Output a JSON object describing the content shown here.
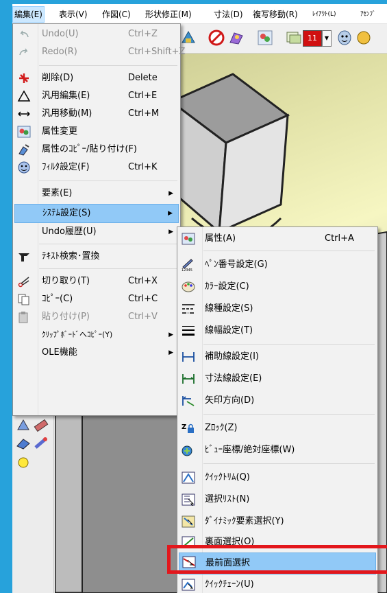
{
  "menubar": {
    "items": [
      {
        "label": "編集(E)"
      },
      {
        "label": "表示(V)"
      },
      {
        "label": "作図(C)"
      },
      {
        "label": "形状修正(M)"
      },
      {
        "label": "寸法(D)"
      },
      {
        "label": "複写移動(R)"
      },
      {
        "label": "ﾚｲｱｳﾄ(L)"
      },
      {
        "label": "ｱｾﾝﾌﾞ"
      }
    ]
  },
  "toolbar": {
    "color_value": "11",
    "colors": {
      "accent": "#e3171c",
      "selection": "#91c9f7",
      "background": "#27a2db"
    }
  },
  "edit_menu": {
    "items": [
      {
        "label": "Undo(U)",
        "shortcut": "Ctrl+Z",
        "icon": "undo-icon",
        "disabled": true
      },
      {
        "label": "Redo(R)",
        "shortcut": "Ctrl+Shift+Z",
        "icon": "redo-icon",
        "disabled": true
      },
      {
        "label": "削除(D)",
        "shortcut": "Delete",
        "icon": "delete-icon"
      },
      {
        "label": "汎用編集(E)",
        "shortcut": "Ctrl+E",
        "icon": "triangle-icon"
      },
      {
        "label": "汎用移動(M)",
        "shortcut": "Ctrl+M",
        "icon": "move-arrows-icon"
      },
      {
        "label": "属性変更",
        "shortcut": "",
        "icon": "attribute-change-icon"
      },
      {
        "label": "属性のｺﾋﾟｰ/貼り付け(F)",
        "shortcut": "",
        "icon": "attribute-copy-icon"
      },
      {
        "label": "ﾌｨﾙﾀ設定(F)",
        "shortcut": "Ctrl+K",
        "icon": "filter-icon"
      },
      {
        "label": "要素(E)",
        "submenu": true
      },
      {
        "label": "ｼｽﾃﾑ設定(S)",
        "submenu": true,
        "highlighted": true
      },
      {
        "label": "Undo履歴(U)",
        "submenu": true
      },
      {
        "label": "ﾃｷｽﾄ検索･置換",
        "icon": "text-search-icon"
      },
      {
        "label": "切り取り(T)",
        "shortcut": "Ctrl+X",
        "icon": "scissors-icon"
      },
      {
        "label": "ｺﾋﾟｰ(C)",
        "shortcut": "Ctrl+C",
        "icon": "copy-icon"
      },
      {
        "label": "貼り付け(P)",
        "shortcut": "Ctrl+V",
        "icon": "paste-icon",
        "disabled": true
      },
      {
        "label": "ｸﾘｯﾌﾟﾎﾞｰﾄﾞへｺﾋﾟｰ(Y)",
        "submenu": true
      },
      {
        "label": "OLE機能",
        "submenu": true
      }
    ]
  },
  "system_submenu": {
    "items": [
      {
        "label": "属性(A)",
        "shortcut": "Ctrl+A",
        "icon": "attribute-icon"
      },
      {
        "label": "ﾍﾟﾝ番号設定(G)",
        "icon": "pen-number-icon",
        "icon_text": "12345"
      },
      {
        "label": "ｶﾗｰ設定(C)",
        "icon": "color-palette-icon"
      },
      {
        "label": "線種設定(S)",
        "icon": "line-type-icon"
      },
      {
        "label": "線幅設定(T)",
        "icon": "line-width-icon"
      },
      {
        "label": "補助線設定(I)",
        "icon": "auxiliary-line-icon"
      },
      {
        "label": "寸法線設定(E)",
        "icon": "dimension-line-icon"
      },
      {
        "label": "矢印方向(D)",
        "icon": "arrow-direction-icon"
      },
      {
        "label": "Zﾛｯｸ(Z)",
        "icon": "z-lock-icon"
      },
      {
        "label": "ﾋﾞｭｰ座標/絶対座標(W)",
        "icon": "view-coordinate-icon"
      },
      {
        "label": "ｸｲｯｸﾄﾘﾑ(Q)",
        "icon": "quick-trim-icon"
      },
      {
        "label": "選択ﾘｽﾄ(N)",
        "icon": "selection-list-icon"
      },
      {
        "label": "ﾀﾞｲﾅﾐｯｸ要素選択(Y)",
        "icon": "dynamic-select-icon"
      },
      {
        "label": "裏面選択(O)",
        "icon": "back-select-icon"
      },
      {
        "label": "最前面選択",
        "icon": "front-select-icon",
        "highlighted": true
      },
      {
        "label": "ｸｲｯｸﾁｪｰﾝ(U)",
        "icon": "quick-chain-icon"
      }
    ]
  }
}
